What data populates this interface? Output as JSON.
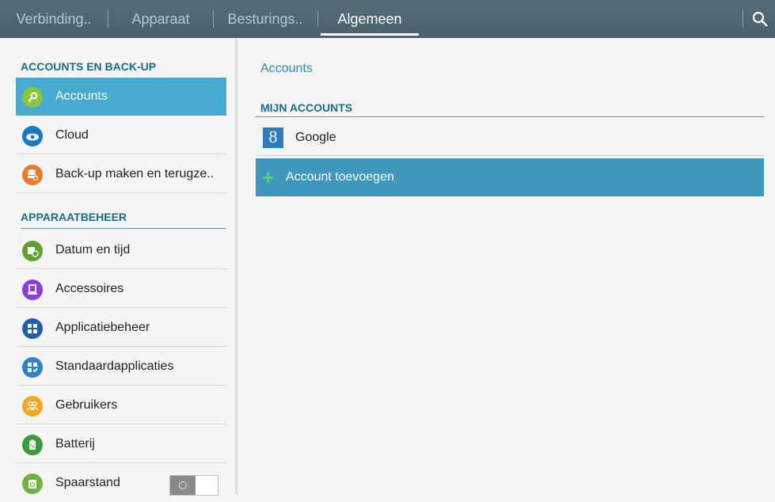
{
  "tabs": [
    {
      "label": "Verbinding.."
    },
    {
      "label": "Apparaat"
    },
    {
      "label": "Besturings.."
    },
    {
      "label": "Algemeen",
      "active": true
    }
  ],
  "sidebar": {
    "sections": [
      {
        "header": "ACCOUNTS EN BACK-UP",
        "items": [
          {
            "label": "Accounts",
            "icon": "key-icon",
            "color": "#8cc63f",
            "selected": true
          },
          {
            "label": "Cloud",
            "icon": "cloud-icon",
            "color": "#1b78c4"
          },
          {
            "label": "Back-up maken en terugze..",
            "icon": "backup-icon",
            "color": "#f0772b"
          }
        ]
      },
      {
        "header": "APPARAATBEHEER",
        "items": [
          {
            "label": "Datum en tijd",
            "icon": "calendar-clock-icon",
            "color": "#5fa02f"
          },
          {
            "label": "Accessoires",
            "icon": "accessory-icon",
            "color": "#8a3ed6"
          },
          {
            "label": "Applicatiebeheer",
            "icon": "app-grid-icon",
            "color": "#1e5fb0"
          },
          {
            "label": "Standaardapplicaties",
            "icon": "default-apps-icon",
            "color": "#2d82c8"
          },
          {
            "label": "Gebruikers",
            "icon": "users-icon",
            "color": "#f0a823"
          },
          {
            "label": "Batterij",
            "icon": "battery-icon",
            "color": "#3a9c3f"
          },
          {
            "label": "Spaarstand",
            "icon": "power-saving-icon",
            "color": "#6fb43c",
            "toggle": "off"
          }
        ]
      }
    ]
  },
  "main": {
    "title": "Accounts",
    "section_header": "MIJN ACCOUNTS",
    "accounts": [
      {
        "label": "Google",
        "icon_letter": "8"
      }
    ],
    "add_account_label": "Account toevoegen"
  }
}
